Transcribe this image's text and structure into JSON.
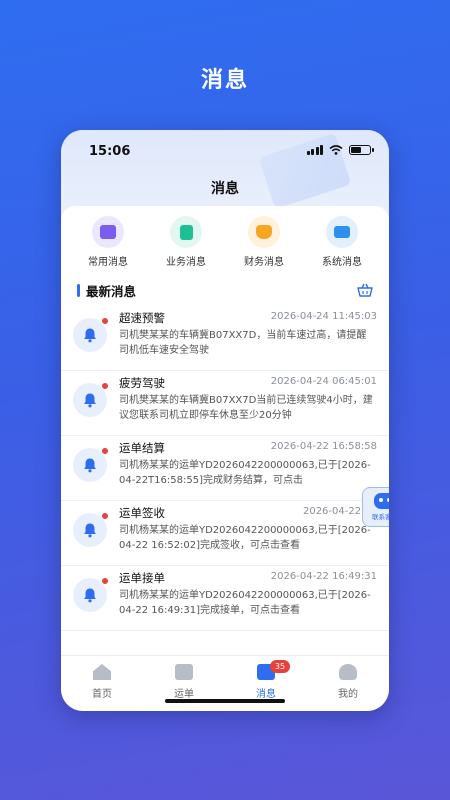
{
  "page": {
    "title": "消息"
  },
  "status_bar": {
    "time": "15:06"
  },
  "header": {
    "title": "消息"
  },
  "categories": [
    {
      "label": "常用消息",
      "icon": "inbox-icon",
      "color": "#7b5cf0",
      "bg": "#ece7ff"
    },
    {
      "label": "业务消息",
      "icon": "document-icon",
      "color": "#1fbf96",
      "bg": "#e2f7f1"
    },
    {
      "label": "财务消息",
      "icon": "money-icon",
      "color": "#f6a623",
      "bg": "#fff1db"
    },
    {
      "label": "系统消息",
      "icon": "monitor-icon",
      "color": "#2f8fee",
      "bg": "#e2f0fd"
    }
  ],
  "section": {
    "title": "最新消息",
    "clear_icon": "basket-icon"
  },
  "messages": [
    {
      "title": "超速预警",
      "time": "2026-04-24 11:45:03",
      "body": "司机樊某某的车辆冀B07XX7D，当前车速过高，请提醒司机低车速安全驾驶"
    },
    {
      "title": "疲劳驾驶",
      "time": "2026-04-24 06:45:01",
      "body": "司机樊某某的车辆冀B07XX7D当前已连续驾驶4小时，建议您联系司机立即停车休息至少20分钟"
    },
    {
      "title": "运单结算",
      "time": "2026-04-22 16:58:58",
      "body": "司机杨某某的运单YD2026042200000063,已于[2026-04-22T16:58:55]完成财务结算，可点击"
    },
    {
      "title": "运单签收",
      "time": "2026-04-22 16",
      "body": "司机杨某某的运单YD2026042200000063,已于[2026-04-22 16:52:02]完成签收，可点击查看"
    },
    {
      "title": "运单接单",
      "time": "2026-04-22 16:49:31",
      "body": "司机杨某某的运单YD2026042200000063,已于[2026-04-22 16:49:31]完成接单，可点击查看"
    }
  ],
  "float_button": {
    "label": "联系客服"
  },
  "tabs": [
    {
      "label": "首页",
      "icon": "home-icon"
    },
    {
      "label": "运单",
      "icon": "waybill-icon"
    },
    {
      "label": "消息",
      "icon": "message-icon",
      "badge": "35",
      "active": true
    },
    {
      "label": "我的",
      "icon": "user-icon"
    }
  ],
  "colors": {
    "accent": "#2f6df0",
    "badge": "#e8413a"
  }
}
